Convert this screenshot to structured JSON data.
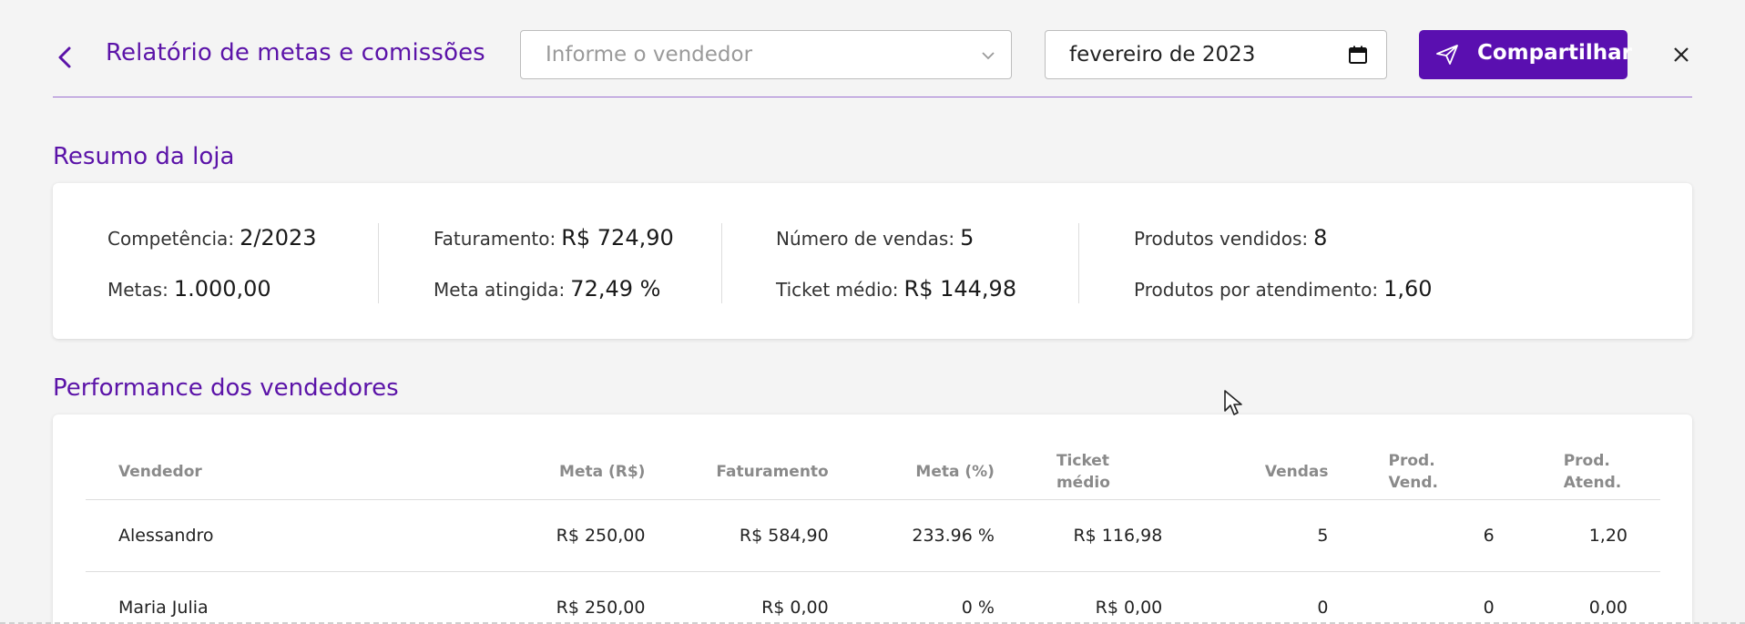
{
  "header": {
    "title": "Relatório de metas e comissões",
    "vendor_placeholder": "Informe o vendedor",
    "period_value": "fevereiro de 2023",
    "share_label": "Compartilhar"
  },
  "summary": {
    "section_title": "Resumo da loja",
    "competencia": {
      "label": "Competência:",
      "value": "2/2023"
    },
    "metas": {
      "label": "Metas:",
      "value": "1.000,00"
    },
    "faturamento": {
      "label": "Faturamento:",
      "value": "R$ 724,90"
    },
    "meta_atingida": {
      "label": "Meta atingida:",
      "value": "72,49 %"
    },
    "numero_vendas": {
      "label": "Número de vendas:",
      "value": "5"
    },
    "ticket_medio": {
      "label": "Ticket médio:",
      "value": "R$ 144,98"
    },
    "produtos_vendidos": {
      "label": "Produtos vendidos:",
      "value": "8"
    },
    "produtos_atendimento": {
      "label": "Produtos por atendimento:",
      "value": "1,60"
    }
  },
  "performance": {
    "section_title": "Performance dos vendedores",
    "columns": [
      {
        "line1": "Vendedor",
        "line2": ""
      },
      {
        "line1": "Meta (R$)",
        "line2": ""
      },
      {
        "line1": "Faturamento",
        "line2": ""
      },
      {
        "line1": "Meta (%)",
        "line2": ""
      },
      {
        "line1": "Ticket",
        "line2": "médio"
      },
      {
        "line1": "Vendas",
        "line2": ""
      },
      {
        "line1": "Prod.",
        "line2": "Vend."
      },
      {
        "line1": "Prod.",
        "line2": "Atend."
      }
    ],
    "rows": [
      [
        "Alessandro",
        "R$ 250,00",
        "R$ 584,90",
        "233.96 %",
        "R$ 116,98",
        "5",
        "6",
        "1,20"
      ],
      [
        "Maria Julia",
        "R$ 250,00",
        "R$ 0,00",
        "0 %",
        "R$ 0,00",
        "0",
        "0",
        "0,00"
      ]
    ]
  },
  "colors": {
    "accent": "#5a0fb0",
    "title": "#5b13a8"
  }
}
